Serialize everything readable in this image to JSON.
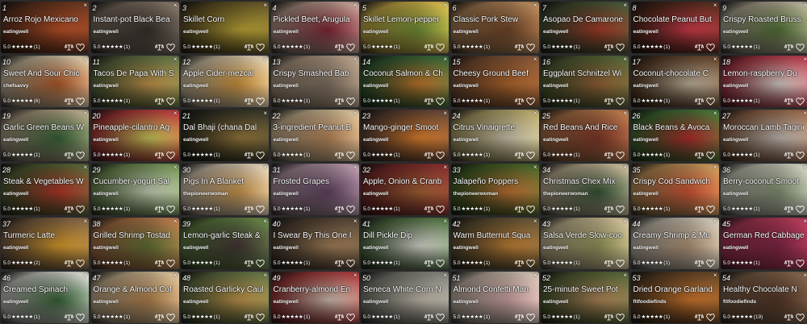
{
  "ui": {
    "close_glyph": "×",
    "star_glyphs": "★★★★★",
    "icons": {
      "scale": "scale-icon",
      "heart": "heart-outline-icon",
      "close": "close-icon"
    }
  },
  "recipes": [
    {
      "num": "1",
      "title": "Arroz Rojo Mexicano",
      "source": "eatingwell",
      "rating": "5.0",
      "count": "(1)",
      "colors": [
        "#c8562a",
        "#6e3a22"
      ]
    },
    {
      "num": "2",
      "title": "Instant-pot Black Bea",
      "source": "eatingwell",
      "rating": "5.0",
      "count": "(1)",
      "colors": [
        "#3a3530",
        "#8a7a6a"
      ]
    },
    {
      "num": "3",
      "title": "Skillet Corn",
      "source": "eatingwell",
      "rating": "5.0",
      "count": "(1)",
      "colors": [
        "#c9b23a",
        "#6b5a2a"
      ]
    },
    {
      "num": "4",
      "title": "Pickled Beet, Arugula",
      "source": "eatingwell",
      "rating": "5.0",
      "count": "(1)",
      "colors": [
        "#8c2a3a",
        "#caa89a"
      ]
    },
    {
      "num": "5",
      "title": "Skillet Lemon-pepper",
      "source": "eatingwell",
      "rating": "5.0",
      "count": "(1)",
      "colors": [
        "#7a9a3a",
        "#e0c050"
      ]
    },
    {
      "num": "6",
      "title": "Classic Pork Stew",
      "source": "eatingwell",
      "rating": "5.0",
      "count": "(1)",
      "colors": [
        "#7a4a2a",
        "#c09060"
      ]
    },
    {
      "num": "7",
      "title": "Asopao De Camarone",
      "source": "eatingwell",
      "rating": "5.0",
      "count": "(1)",
      "colors": [
        "#b0402a",
        "#4a5a3a"
      ]
    },
    {
      "num": "8",
      "title": "Chocolate Peanut But",
      "source": "eatingwell",
      "rating": "5.0",
      "count": "(1)",
      "colors": [
        "#e04050",
        "#5a3020"
      ]
    },
    {
      "num": "9",
      "title": "Crispy Roasted Bruss",
      "source": "eatingwell",
      "rating": "5.0",
      "count": "(1)",
      "colors": [
        "#5a7a3a",
        "#c0b8a0"
      ]
    },
    {
      "num": "10",
      "title": "Sweet And Sour Chic",
      "source": "chefsavvy",
      "rating": "5.0",
      "count": "(6)",
      "colors": [
        "#c0602a",
        "#e0d0b0"
      ]
    },
    {
      "num": "11",
      "title": "Tacos De Papa With S",
      "source": "eatingwell",
      "rating": "5.0",
      "count": "(1)",
      "colors": [
        "#d0a050",
        "#6a7a4a"
      ]
    },
    {
      "num": "12",
      "title": "Apple Cider-mezcal",
      "source": "eatingwell",
      "rating": "5.0",
      "count": "(1)",
      "colors": [
        "#e0a040",
        "#e8d8b8"
      ]
    },
    {
      "num": "13",
      "title": "Crispy Smashed Bab",
      "source": "eatingwell",
      "rating": "5.0",
      "count": "(1)",
      "colors": [
        "#8a7a6a",
        "#c0a890"
      ]
    },
    {
      "num": "14",
      "title": "Coconut Salmon & Ch",
      "source": "eatingwell",
      "rating": "5.0",
      "count": "(1)",
      "colors": [
        "#d08030",
        "#3a6a3a"
      ]
    },
    {
      "num": "15",
      "title": "Cheesy Ground Beef",
      "source": "eatingwell",
      "rating": "5.0",
      "count": "(1)",
      "colors": [
        "#c07030",
        "#8a5a3a"
      ]
    },
    {
      "num": "16",
      "title": "Eggplant Schnitzel Wi",
      "source": "eatingwell",
      "rating": "5.0",
      "count": "(1)",
      "colors": [
        "#a06a3a",
        "#5a6a3a"
      ]
    },
    {
      "num": "17",
      "title": "Coconut-chocolate C",
      "source": "eatingwell",
      "rating": "5.0",
      "count": "(1)",
      "colors": [
        "#d0c0a8",
        "#6a4a30"
      ]
    },
    {
      "num": "18",
      "title": "Lemon-raspberry Du",
      "source": "eatingwell",
      "rating": "5.0",
      "count": "(1)",
      "colors": [
        "#e8e0d8",
        "#c04050"
      ]
    },
    {
      "num": "19",
      "title": "Garlic Green Beans W",
      "source": "eatingwell",
      "rating": "5.0",
      "count": "(1)",
      "colors": [
        "#3a6a3a",
        "#c0b090"
      ]
    },
    {
      "num": "20",
      "title": "Pineapple-cilantro Ag",
      "source": "eatingwell",
      "rating": "5.0",
      "count": "(1)",
      "colors": [
        "#d8d860",
        "#c04040"
      ]
    },
    {
      "num": "21",
      "title": "Dal Bhaji (chana Dal",
      "source": "eatingwell",
      "rating": "5.0",
      "count": "(1)",
      "colors": [
        "#a08040",
        "#3a3a2a"
      ]
    },
    {
      "num": "22",
      "title": "3-ingredient Peanut B",
      "source": "eatingwell",
      "rating": "5.0",
      "count": "(1)",
      "colors": [
        "#c89060",
        "#e0c8a0"
      ]
    },
    {
      "num": "23",
      "title": "Mango-ginger Smoot",
      "source": "eatingwell",
      "rating": "5.0",
      "count": "(1)",
      "colors": [
        "#f08a30",
        "#6a4a3a"
      ]
    },
    {
      "num": "24",
      "title": "Citrus Vinaigrette",
      "source": "eatingwell",
      "rating": "5.0",
      "count": "(1)",
      "colors": [
        "#e0d8c0",
        "#c0b070"
      ]
    },
    {
      "num": "25",
      "title": "Red Beans And Rice",
      "source": "eatingwell",
      "rating": "5.0",
      "count": "(1)",
      "colors": [
        "#8a3a2a",
        "#c08050"
      ]
    },
    {
      "num": "26",
      "title": "Black Beans & Avoca",
      "source": "eatingwell",
      "rating": "5.0",
      "count": "(1)",
      "colors": [
        "#c03030",
        "#4a7a3a"
      ]
    },
    {
      "num": "27",
      "title": "Moroccan Lamb Tagine",
      "source": "eatingwell",
      "rating": "5.0",
      "count": "(1)",
      "colors": [
        "#d0c8c0",
        "#a07050"
      ]
    },
    {
      "num": "28",
      "title": "Steak & Vegetables W",
      "source": "eatingwell",
      "rating": "5.0",
      "count": "(1)",
      "colors": [
        "#c03a2a",
        "#5a6a3a"
      ]
    },
    {
      "num": "29",
      "title": "Cucumber-yogurt Sal",
      "source": "eatingwell",
      "rating": "5.0",
      "count": "(1)",
      "colors": [
        "#d8e0c8",
        "#7a9a5a"
      ]
    },
    {
      "num": "30",
      "title": "Pigs In A Blanket",
      "source": "thepioneerwoman",
      "rating": "5.0",
      "count": "(1)",
      "colors": [
        "#d8a050",
        "#e8d8c0"
      ]
    },
    {
      "num": "31",
      "title": "Frosted Grapes",
      "source": "eatingwell",
      "rating": "5.0",
      "count": "(1)",
      "colors": [
        "#6a4a6a",
        "#c0a0b0"
      ]
    },
    {
      "num": "32",
      "title": "Apple, Onion & Cranb",
      "source": "eatingwell",
      "rating": "5.0",
      "count": "(1)",
      "colors": [
        "#b06a3a",
        "#8a3030"
      ]
    },
    {
      "num": "33",
      "title": "Jalapeño Poppers",
      "source": "thepioneerwoman",
      "rating": "5.0",
      "count": "(1)",
      "colors": [
        "#d07a3a",
        "#4a6a2a"
      ]
    },
    {
      "num": "34",
      "title": "Christmas Chex Mix",
      "source": "thepioneerwoman",
      "rating": "5.0",
      "count": "(1)",
      "colors": [
        "#3a5a3a",
        "#d0c0a0"
      ]
    },
    {
      "num": "35",
      "title": "Crispy Cod Sandwich",
      "source": "eatingwell",
      "rating": "5.0",
      "count": "(1)",
      "colors": [
        "#e05a3a",
        "#d0a060"
      ]
    },
    {
      "num": "36",
      "title": "Berry-coconut Smoot",
      "source": "eatingwell",
      "rating": "5.0",
      "count": "(1)",
      "colors": [
        "#8a9a7a",
        "#d8d8c8"
      ]
    },
    {
      "num": "37",
      "title": "Turmeric Latte",
      "source": "eatingwell",
      "rating": "5.0",
      "count": "(2)",
      "colors": [
        "#e8a830",
        "#8a6a4a"
      ]
    },
    {
      "num": "38",
      "title": "Grilled Shrimp Tostad",
      "source": "eatingwell",
      "rating": "5.0",
      "count": "(1)",
      "colors": [
        "#6a7a3a",
        "#c08050"
      ]
    },
    {
      "num": "39",
      "title": "Lemon-garlic Steak &",
      "source": "eatingwell",
      "rating": "5.0",
      "count": "(1)",
      "colors": [
        "#4a3a3a",
        "#6a8a4a"
      ]
    },
    {
      "num": "40",
      "title": "I Swear By This One I",
      "source": "eatingwell",
      "rating": "5.0",
      "count": "(1)",
      "colors": [
        "#b08a60",
        "#5a4a3a"
      ]
    },
    {
      "num": "41",
      "title": "Dill Pickle Dip",
      "source": "eatingwell",
      "rating": "5.0",
      "count": "(1)",
      "colors": [
        "#e8e8e0",
        "#5a7a4a"
      ]
    },
    {
      "num": "42",
      "title": "Warm Butternut Squa",
      "source": "eatingwell",
      "rating": "5.0",
      "count": "(1)",
      "colors": [
        "#d08a3a",
        "#6a5a3a"
      ]
    },
    {
      "num": "43",
      "title": "Salsa Verde Slow-coo",
      "source": "eatingwell",
      "rating": "5.0",
      "count": "(1)",
      "colors": [
        "#a0a060",
        "#d8c8a0"
      ]
    },
    {
      "num": "44",
      "title": "Creamy Shrimp & Mu",
      "source": "eatingwell",
      "rating": "5.0",
      "count": "(1)",
      "colors": [
        "#c0a080",
        "#d8d0c0"
      ]
    },
    {
      "num": "45",
      "title": "German Red Cabbage",
      "source": "eatingwell",
      "rating": "5.0",
      "count": "(1)",
      "colors": [
        "#8a2a4a",
        "#c04060"
      ]
    },
    {
      "num": "46",
      "title": "Creamed Spinach",
      "source": "eatingwell",
      "rating": "5.0",
      "count": "(1)",
      "colors": [
        "#3a6a3a",
        "#e0e0d8"
      ]
    },
    {
      "num": "47",
      "title": "Orange & Almond Cof",
      "source": "eatingwell",
      "rating": "5.0",
      "count": "(1)",
      "colors": [
        "#c08a50",
        "#e0c8a0"
      ]
    },
    {
      "num": "48",
      "title": "Roasted Garlicky Caul",
      "source": "eatingwell",
      "rating": "5.0",
      "count": "(1)",
      "colors": [
        "#d0a050",
        "#6a7a4a"
      ]
    },
    {
      "num": "49",
      "title": "Cranberry-almond En",
      "source": "eatingwell",
      "rating": "5.0",
      "count": "(1)",
      "colors": [
        "#e0d0c0",
        "#b04040"
      ]
    },
    {
      "num": "50",
      "title": "Seneca White Corn N",
      "source": "eatingwell",
      "rating": "5.0",
      "count": "(1)",
      "colors": [
        "#d0c8b8",
        "#8a8a80"
      ]
    },
    {
      "num": "51",
      "title": "Almond Confetti Man",
      "source": "eatingwell",
      "rating": "5.0",
      "count": "(1)",
      "colors": [
        "#e0b0b0",
        "#d8c8b8"
      ]
    },
    {
      "num": "52",
      "title": "25-minute Sweet Pot",
      "source": "eatingwell",
      "rating": "5.0",
      "count": "(1)",
      "colors": [
        "#c09060",
        "#5a6a3a"
      ]
    },
    {
      "num": "53",
      "title": "Dried Orange Garland",
      "source": "fitfoodiefinds",
      "rating": "5.0",
      "count": "(1)",
      "colors": [
        "#e08030",
        "#6a4a2a"
      ]
    },
    {
      "num": "54",
      "title": "Healthy Chocolate N",
      "source": "fitfoodiefinds",
      "rating": "5.0",
      "count": "(19)",
      "colors": [
        "#5a3a2a",
        "#8a6a50"
      ]
    }
  ]
}
